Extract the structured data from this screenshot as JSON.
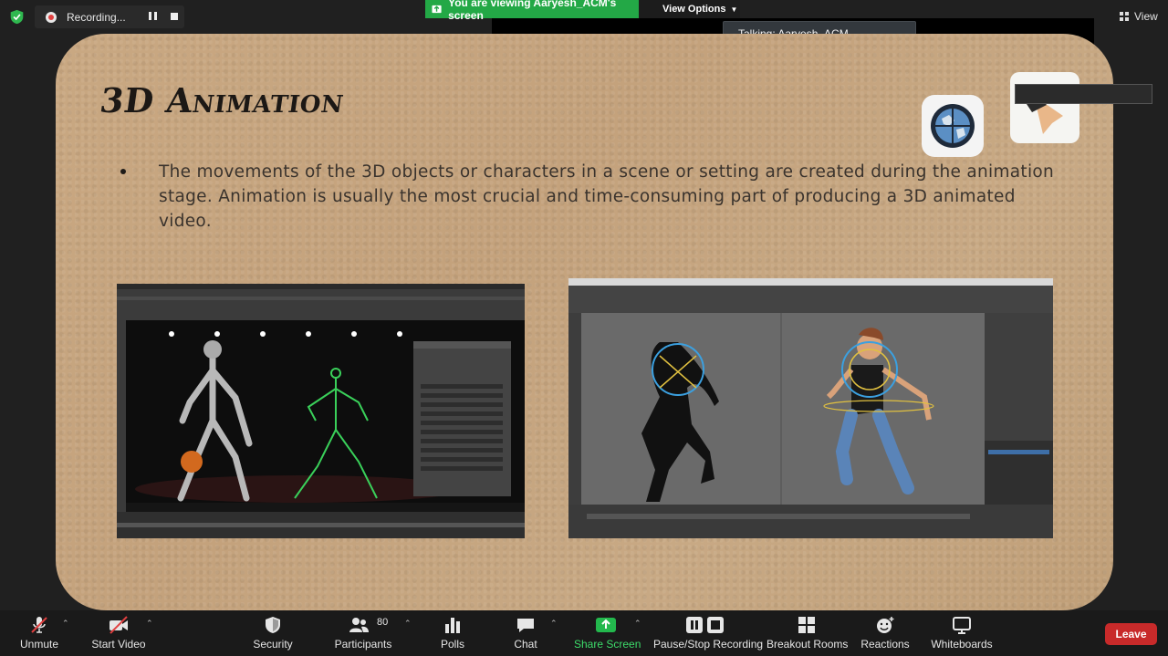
{
  "meeting": {
    "recording_label": "Recording...",
    "viewing_banner": "You are viewing Aaryesh_ACM's screen",
    "view_options": "View Options",
    "talking": "Talking: Aaryesh_ACM",
    "view_label": "View"
  },
  "slide": {
    "title": "3D Animation",
    "body": "The movements of the 3D objects or characters in a scene or setting are created during the animation stage. Animation is usually the most crucial and time-consuming part of producing a 3D animated video."
  },
  "toolbar": {
    "unmute": "Unmute",
    "start_video": "Start Video",
    "security": "Security",
    "participants": "Participants",
    "participants_count": "80",
    "polls": "Polls",
    "chat": "Chat",
    "share_screen": "Share Screen",
    "pause_stop_recording": "Pause/Stop Recording",
    "breakout_rooms": "Breakout Rooms",
    "reactions": "Reactions",
    "whiteboards": "Whiteboards",
    "leave": "Leave"
  },
  "colors": {
    "share_green": "#23a846",
    "leave_red": "#c82a2a",
    "slide_bg": "#c6a57f"
  }
}
